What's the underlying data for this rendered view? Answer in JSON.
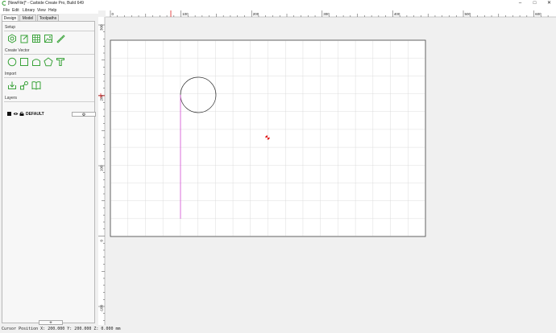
{
  "window": {
    "title": "[NewFile]* - Carbide Create Pro, Build 649",
    "minimize_icon": "minimize-icon",
    "maximize_icon": "maximize-icon",
    "close_icon": "close-icon"
  },
  "menu": {
    "items": [
      "File",
      "Edit",
      "Library",
      "View",
      "Help"
    ]
  },
  "tabs": [
    "Design",
    "Model",
    "Toolpaths"
  ],
  "sections": {
    "setup": "Setup",
    "create_vector": "Create Vector",
    "import": "Import",
    "layers": "Layers"
  },
  "tools": {
    "setup": [
      "job-setup-icon",
      "new-file-icon",
      "grid-icon",
      "background-image-icon",
      "measure-icon"
    ],
    "create_vector": [
      "circle-icon",
      "rectangle-icon",
      "polygon-icon",
      "star-icon",
      "text-icon"
    ],
    "import": [
      "import-vector-icon",
      "import-svg-icon",
      "library-icon"
    ]
  },
  "layers": [
    {
      "name": "DEFAULT",
      "settings_icon": "gear-icon"
    }
  ],
  "add_layer_label": "+",
  "rulers": {
    "top_labels": [
      "0",
      "100",
      "200",
      "300",
      "400",
      "500",
      "600"
    ],
    "left_labels": [
      "300",
      "200",
      "100",
      "0",
      "-100"
    ]
  },
  "status": {
    "cursor_position": "Cursor Position X: 200.000 Y: 200.000 Z: 0.000 mm"
  },
  "colors": {
    "accent_green": "#3aa33a",
    "selection_magenta": "#d64fd6",
    "origin_red": "#e02020"
  }
}
